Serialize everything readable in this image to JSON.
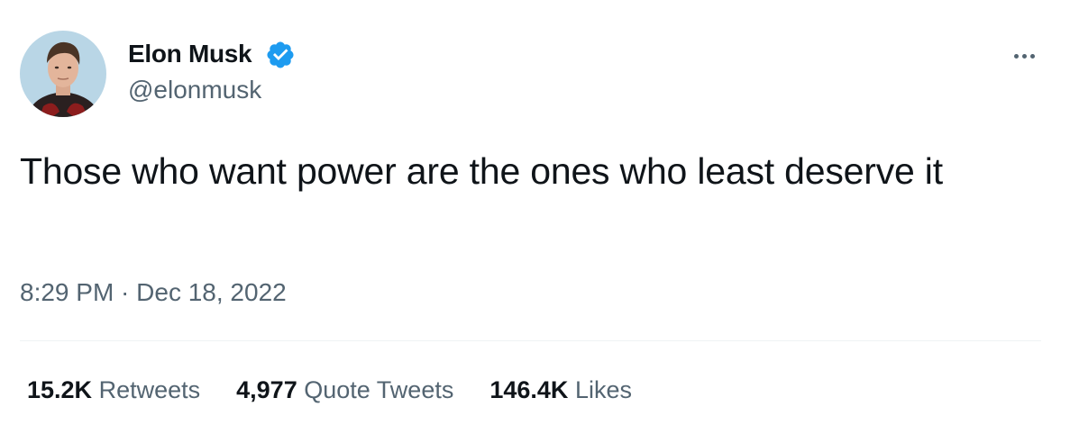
{
  "author": {
    "name": "Elon Musk",
    "handle": "@elonmusk",
    "verified": true
  },
  "tweet": {
    "text": "Those who want power are the ones who least deserve it",
    "timestamp": "8:29 PM · Dec 18, 2022"
  },
  "stats": [
    {
      "count": "15.2K",
      "label": "Retweets"
    },
    {
      "count": "4,977",
      "label": "Quote Tweets"
    },
    {
      "count": "146.4K",
      "label": "Likes"
    }
  ],
  "icons": {
    "verified": "verified-badge-icon",
    "more": "more-horizontal-icon"
  },
  "colors": {
    "verified_blue": "#1d9bf0",
    "text_primary": "#0f1419",
    "text_secondary": "#536471",
    "divider": "#eff3f4"
  }
}
